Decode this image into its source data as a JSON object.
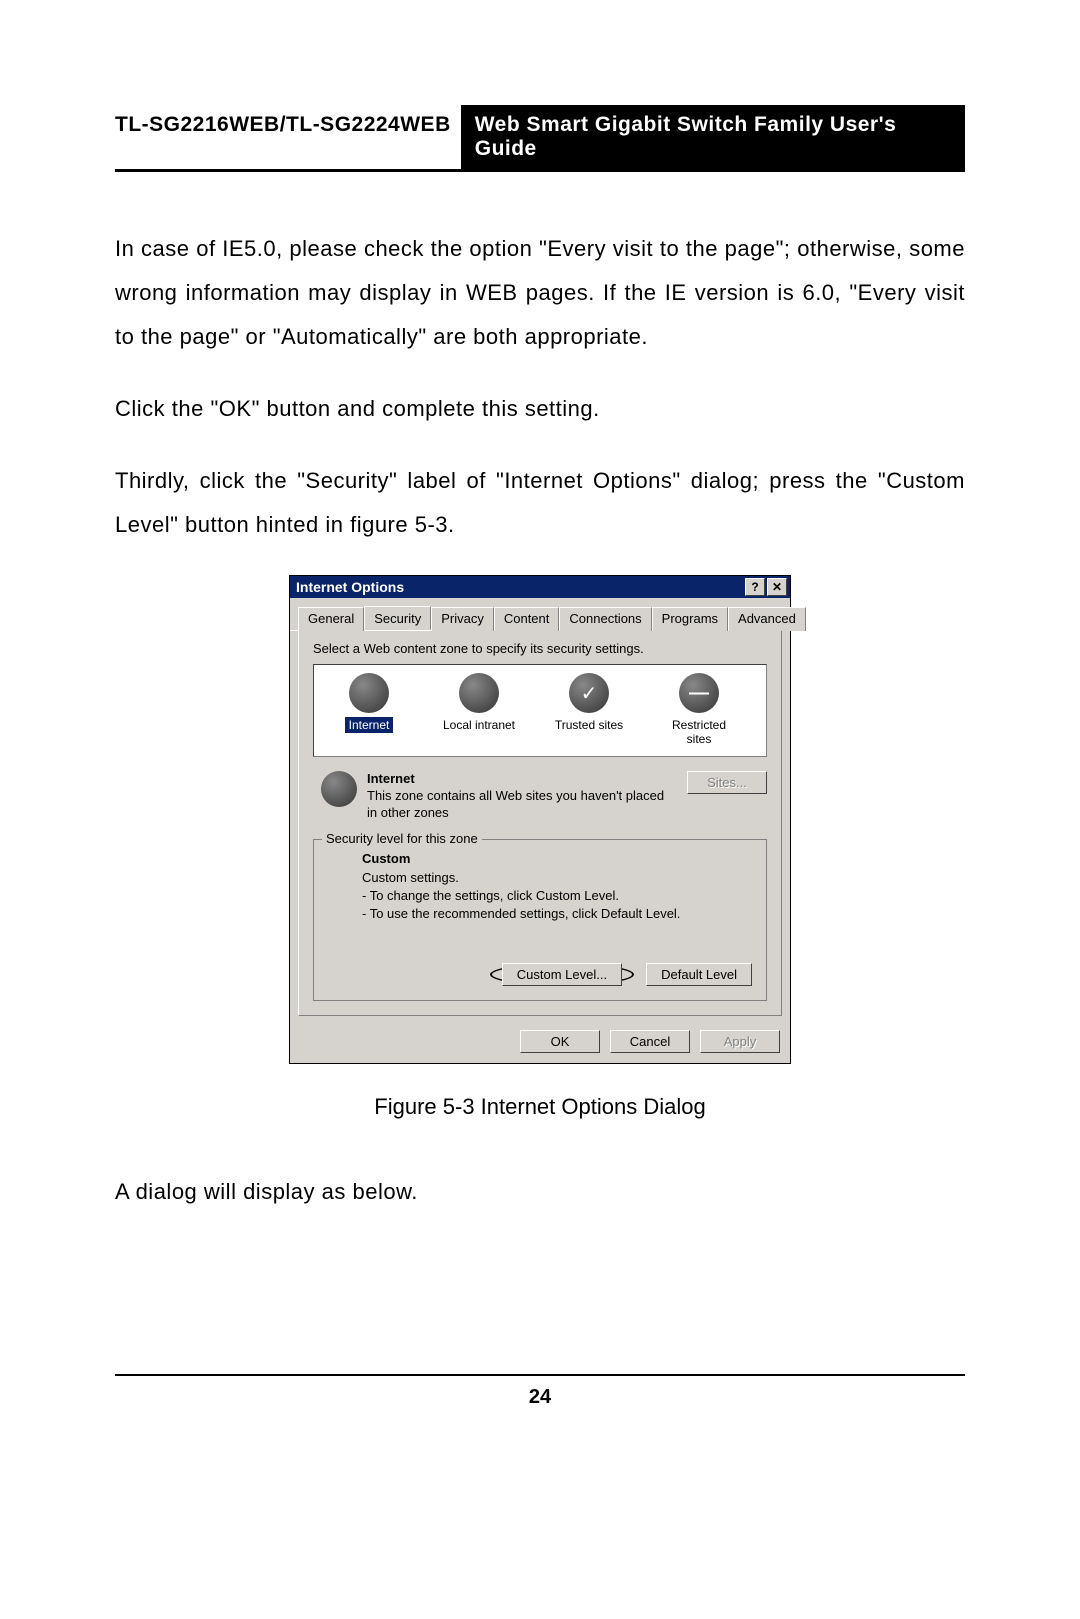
{
  "header": {
    "left": "TL-SG2216WEB/TL-SG2224WEB",
    "right": "Web Smart Gigabit Switch Family User's Guide"
  },
  "paragraphs": {
    "p1": "In case of IE5.0, please check the option \"Every visit to the page\"; otherwise, some wrong information may display in WEB pages. If the IE version is 6.0, \"Every visit to the page\" or \"Automatically\" are both appropriate.",
    "p2": "Click the \"OK\" button and complete this setting.",
    "p3": "Thirdly, click the \"Security\" label of \"Internet Options\" dialog; press the \"Custom Level\" button hinted in figure 5-3.",
    "p4": "A dialog will display as below."
  },
  "dialog": {
    "title": "Internet Options",
    "help_glyph": "?",
    "close_glyph": "✕",
    "tabs": {
      "general": "General",
      "security": "Security",
      "privacy": "Privacy",
      "content": "Content",
      "connections": "Connections",
      "programs": "Programs",
      "advanced": "Advanced"
    },
    "instruction": "Select a Web content zone to specify its security settings.",
    "zones": {
      "internet": "Internet",
      "local": "Local intranet",
      "trusted": "Trusted sites",
      "restricted": "Restricted sites"
    },
    "zone_detail": {
      "name": "Internet",
      "desc": "This zone contains all Web sites you haven't placed in other zones"
    },
    "sites_btn": "Sites...",
    "fieldset_legend": "Security level for this zone",
    "custom_title": "Custom",
    "custom_sub": "Custom settings.",
    "custom_line1": "- To change the settings, click Custom Level.",
    "custom_line2": "- To use the recommended settings, click Default Level.",
    "custom_level_btn": "Custom Level...",
    "default_level_btn": "Default Level",
    "ok_btn": "OK",
    "cancel_btn": "Cancel",
    "apply_btn": "Apply"
  },
  "figure_caption": "Figure 5-3  Internet Options Dialog",
  "page_number": "24"
}
